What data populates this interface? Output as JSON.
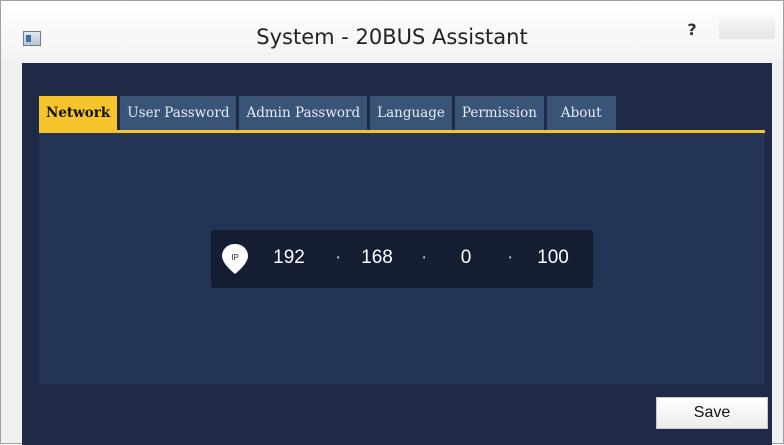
{
  "window": {
    "title": "System - 20BUS Assistant",
    "help_label": "?"
  },
  "tabs": [
    {
      "label": "Network",
      "active": true
    },
    {
      "label": "User Password",
      "active": false
    },
    {
      "label": "Admin Password",
      "active": false
    },
    {
      "label": "Language",
      "active": false
    },
    {
      "label": "Permission",
      "active": false
    },
    {
      "label": "About",
      "active": false
    }
  ],
  "network": {
    "ip_icon": "ip-pin-icon",
    "ip_icon_label": "IP",
    "ip": [
      "192",
      "168",
      "0",
      "100"
    ],
    "separator": "·"
  },
  "footer": {
    "save_label": "Save"
  },
  "colors": {
    "accent": "#f5c52b",
    "background": "#1f2b46",
    "tab": "#3a5478"
  }
}
